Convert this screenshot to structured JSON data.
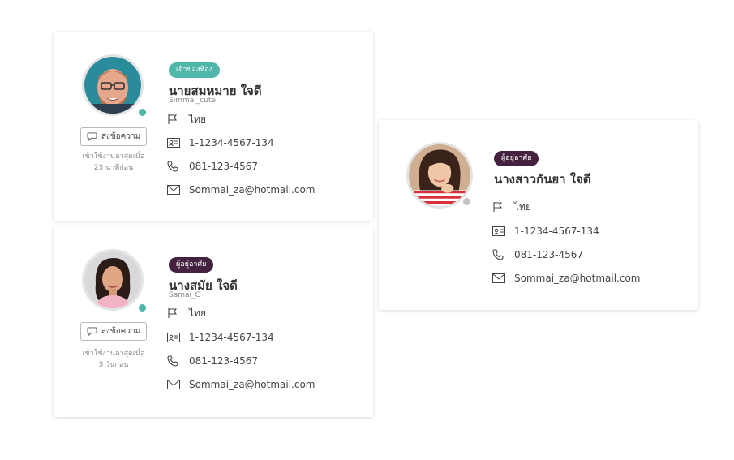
{
  "colors": {
    "owner_badge": "#4fb6a9",
    "resident_badge": "#43213f",
    "online": "#4fb6a9",
    "offline": "#c4c4c4"
  },
  "cards": [
    {
      "role": "เจ้าของห้อง",
      "name": "นายสมหมาย  ใจดี",
      "username": "Simmai_cute",
      "nationality": "ไทย",
      "id_number": "1-1234-4567-134",
      "phone": "081-123-4567",
      "email": "Sommai_za@hotmail.com",
      "message_button": "ส่งข้อความ",
      "last_seen_line1": "เข้าใช้งานล่าสุดเมื่อ",
      "last_seen_line2": "23 นาทีก่อน",
      "status": "online"
    },
    {
      "role": "ผู้อยู่อาศัย",
      "name": "นางสมัย  ใจดี",
      "username": "Samai_C",
      "nationality": "ไทย",
      "id_number": "1-1234-4567-134",
      "phone": "081-123-4567",
      "email": "Sommai_za@hotmail.com",
      "message_button": "ส่งข้อความ",
      "last_seen_line1": "เข้าใช้งานล่าสุดเมื่อ",
      "last_seen_line2": "3 วันก่อน",
      "status": "online"
    },
    {
      "role": "ผู้อยู่อาศัย",
      "name": "นางสาวกันยา  ใจดี",
      "nationality": "ไทย",
      "id_number": "1-1234-4567-134",
      "phone": "081-123-4567",
      "email": "Sommai_za@hotmail.com",
      "status": "offline"
    }
  ],
  "icons": [
    "chat-bubble-icon",
    "flag-icon",
    "id-card-icon",
    "phone-icon",
    "mail-icon"
  ]
}
